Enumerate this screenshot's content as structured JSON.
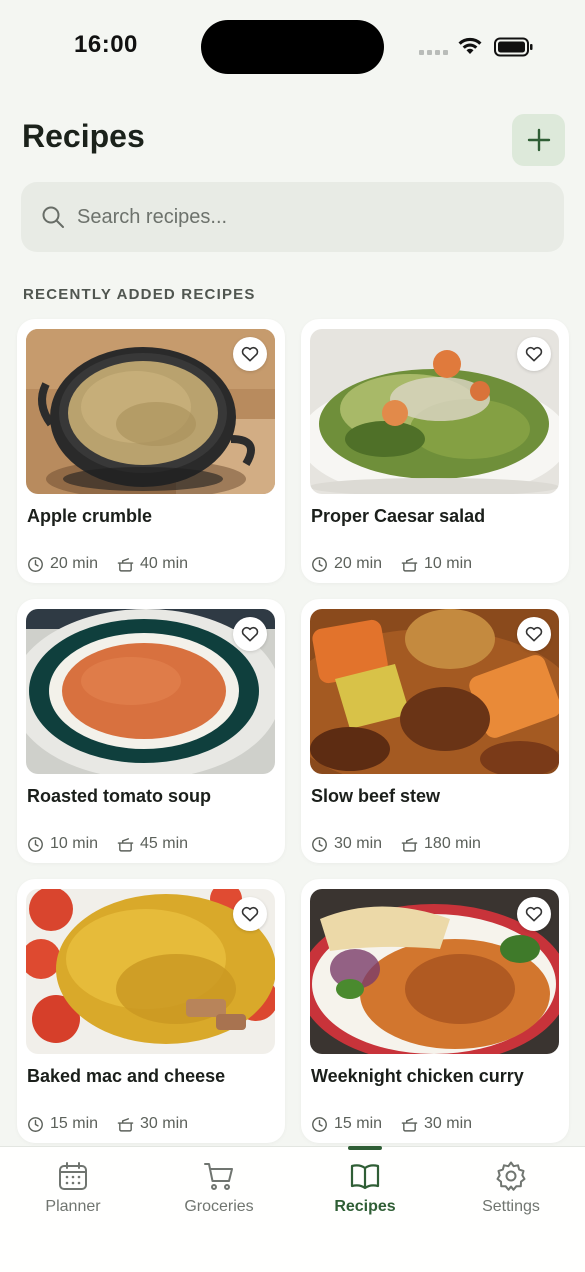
{
  "status_bar": {
    "time": "16:00"
  },
  "header": {
    "title": "Recipes",
    "add_icon": "plus-icon"
  },
  "search": {
    "placeholder": "Search recipes..."
  },
  "section": {
    "label": "RECENTLY ADDED RECIPES"
  },
  "recipes": [
    {
      "title": "Apple crumble",
      "prep": "20 min",
      "cook": "40 min",
      "image": "apple-crumble-photo"
    },
    {
      "title": "Proper Caesar salad",
      "prep": "20 min",
      "cook": "10 min",
      "image": "caesar-salad-photo"
    },
    {
      "title": "Roasted tomato soup",
      "prep": "10 min",
      "cook": "45 min",
      "image": "tomato-soup-photo"
    },
    {
      "title": "Slow beef stew",
      "prep": "30 min",
      "cook": "180 min",
      "image": "beef-stew-photo"
    },
    {
      "title": "Baked mac and cheese",
      "prep": "15 min",
      "cook": "30 min",
      "image": "mac-and-cheese-photo"
    },
    {
      "title": "Weeknight chicken curry",
      "prep": "15 min",
      "cook": "30 min",
      "image": "chicken-curry-photo"
    }
  ],
  "tabs": [
    {
      "label": "Planner",
      "icon": "calendar-icon",
      "active": false
    },
    {
      "label": "Groceries",
      "icon": "cart-icon",
      "active": false
    },
    {
      "label": "Recipes",
      "icon": "book-icon",
      "active": true
    },
    {
      "label": "Settings",
      "icon": "gear-icon",
      "active": false
    }
  ],
  "colors": {
    "background": "#f4f6f2",
    "accent": "#2f5e35",
    "accent_soft": "#dde9da",
    "search_bg": "#e8ebe5"
  }
}
